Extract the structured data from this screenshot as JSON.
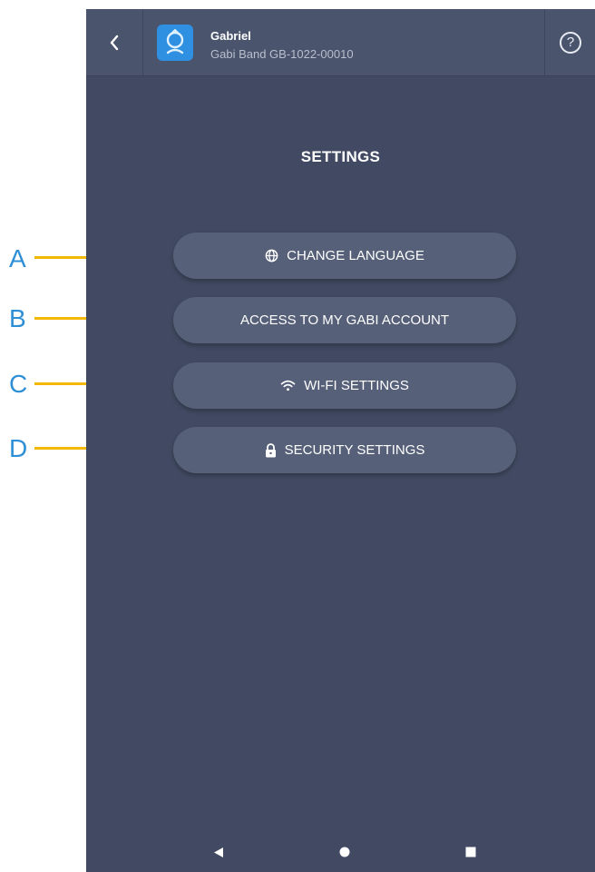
{
  "header": {
    "device_name": "Gabriel",
    "device_serial": "Gabi Band GB-1022-00010",
    "help_label": "?"
  },
  "page": {
    "title": "SETTINGS"
  },
  "menu": {
    "items": [
      {
        "label": "CHANGE LANGUAGE",
        "icon": "globe-icon"
      },
      {
        "label": "ACCESS TO MY GABI ACCOUNT",
        "icon": ""
      },
      {
        "label": "WI-FI SETTINGS",
        "icon": "wifi-icon"
      },
      {
        "label": "SECURITY SETTINGS",
        "icon": "lock-icon"
      }
    ]
  },
  "annotations": {
    "labels": [
      "A",
      "B",
      "C",
      "D"
    ]
  },
  "colors": {
    "screen_bg": "#414a62",
    "header_bg": "#4a546d",
    "button_bg": "#566079",
    "avatar_bg": "#2f8fe0",
    "annotation_letter": "#2f8fd6",
    "annotation_line": "#f5b800"
  }
}
